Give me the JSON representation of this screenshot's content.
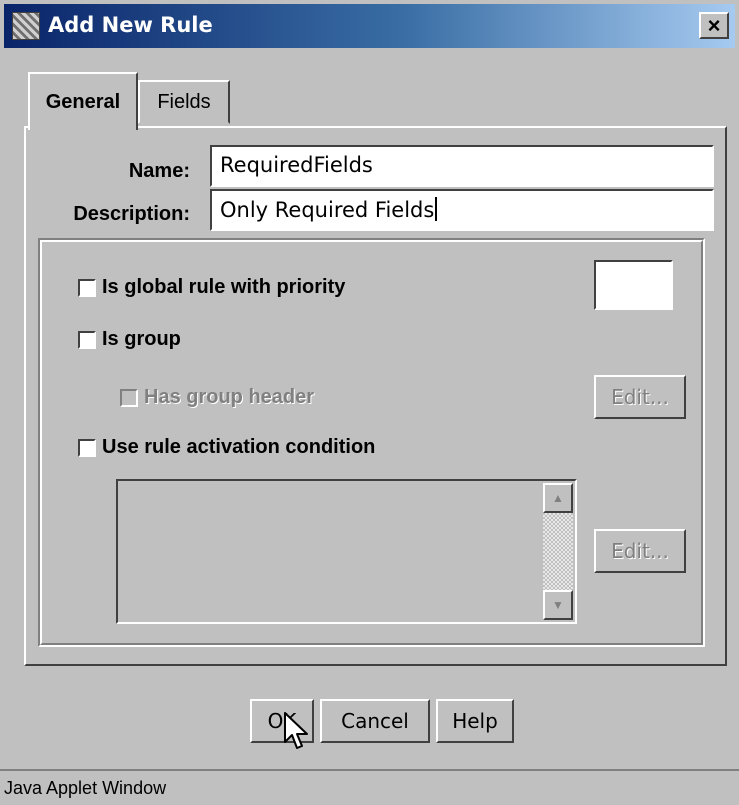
{
  "window": {
    "title": "Add New Rule",
    "close_symbol": "×",
    "icon": "applet-icon"
  },
  "tabs": [
    {
      "label": "General",
      "selected": true
    },
    {
      "label": "Fields",
      "selected": false
    }
  ],
  "form": {
    "name_label": "Name:",
    "name_value": "RequiredFields",
    "description_label": "Description:",
    "description_value": "Only Required Fields"
  },
  "options": {
    "global_rule_label": "Is global rule with priority",
    "global_rule_checked": false,
    "priority_value": "",
    "is_group_label": "Is group",
    "is_group_checked": false,
    "has_group_header_label": "Has group header",
    "has_group_header_enabled": false,
    "edit_header_button": "Edit...",
    "activation_label": "Use rule activation condition",
    "activation_checked": false,
    "edit_condition_button": "Edit..."
  },
  "buttons": {
    "ok": "OK",
    "cancel": "Cancel",
    "help": "Help"
  },
  "status": {
    "text": "Java Applet Window"
  },
  "colors": {
    "face": "#c0c0c0",
    "title_start": "#0a246a",
    "title_end": "#a6caf0",
    "disabled_text": "#808080"
  }
}
